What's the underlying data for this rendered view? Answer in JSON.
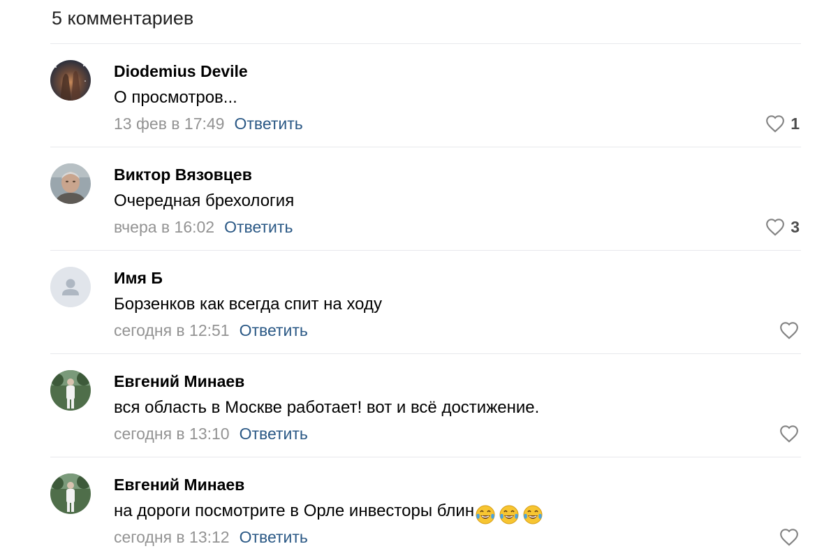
{
  "header": {
    "title": "5 комментариев"
  },
  "colors": {
    "link": "#2a5885",
    "meta": "#939393",
    "divider": "#e7e8ec",
    "heart": "#828282"
  },
  "comments": [
    {
      "author": "Diodemius Devile",
      "text": "О просмотров...",
      "date": "13 фев в 17:49",
      "reply_label": "Ответить",
      "likes": "1",
      "avatar": "space-nebula-photo",
      "emojis": []
    },
    {
      "author": "Виктор Вязовцев",
      "text": "Очередная брехология",
      "date": "вчера в 16:02",
      "reply_label": "Ответить",
      "likes": "3",
      "avatar": "man-portrait-photo",
      "emojis": []
    },
    {
      "author": "Имя Б",
      "text": "Борзенков как всегда спит на ходу",
      "date": "сегодня в 12:51",
      "reply_label": "Ответить",
      "likes": "",
      "avatar": "default-user-icon",
      "emojis": []
    },
    {
      "author": "Евгений Минаев",
      "text": "вся область в Москве работает! вот и всё достижение.",
      "date": "сегодня в 13:10",
      "reply_label": "Ответить",
      "likes": "",
      "avatar": "man-outdoor-photo",
      "emojis": []
    },
    {
      "author": "Евгений Минаев",
      "text": "на дороги посмотрите в Орле инвесторы блин",
      "date": "сегодня в 13:12",
      "reply_label": "Ответить",
      "likes": "",
      "avatar": "man-outdoor-photo",
      "emojis": [
        "😂",
        "😂",
        "😂"
      ]
    }
  ]
}
